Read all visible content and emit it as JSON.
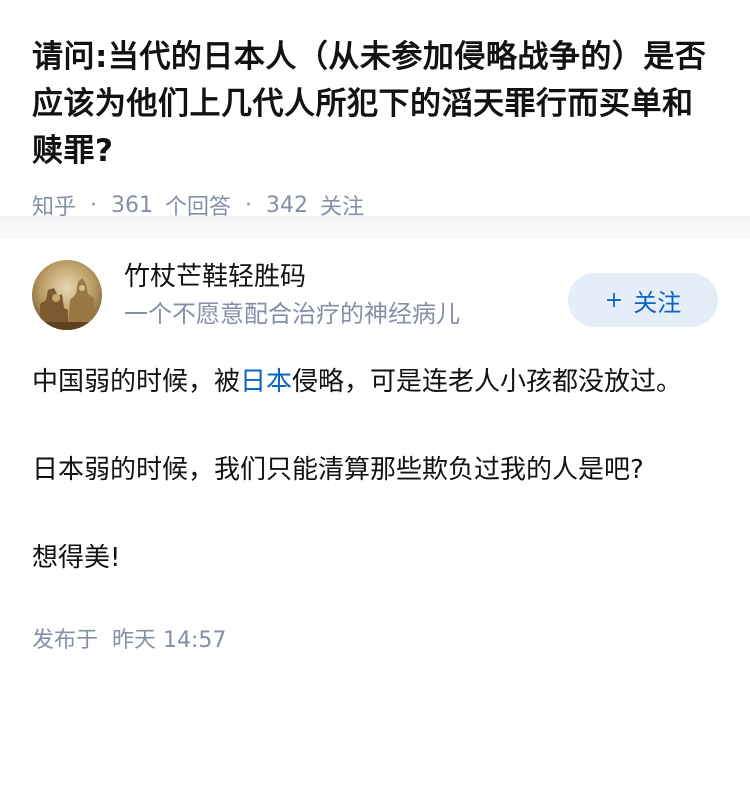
{
  "question": {
    "title": "请问:当代的日本人（从未参加侵略战争的）是否应该为他们上几代人所犯下的滔天罪行而买单和赎罪?",
    "source": "知乎",
    "answers_count": "361",
    "answers_label": "个回答",
    "followers_count": "342",
    "followers_label": "关注",
    "separator": "·"
  },
  "author": {
    "name": "竹杖芒鞋轻胜码",
    "headline": "一个不愿意配合治疗的神经病儿",
    "avatar_icon": "avatar-image",
    "follow_plus": "+",
    "follow_label": "关注"
  },
  "answer": {
    "p1_before": "中国弱的时候，被",
    "p1_link": "日本",
    "p1_after": "侵略，可是连老人小孩都没放过。",
    "p2": "日本弱的时候，我们只能清算那些欺负过我的人是吧?",
    "p3": "想得美!",
    "publish_label": "发布于",
    "publish_time": "昨天 14:57"
  },
  "colors": {
    "link": "#0a66c2",
    "meta": "#8590a6",
    "follow_bg": "#e5eef8"
  }
}
